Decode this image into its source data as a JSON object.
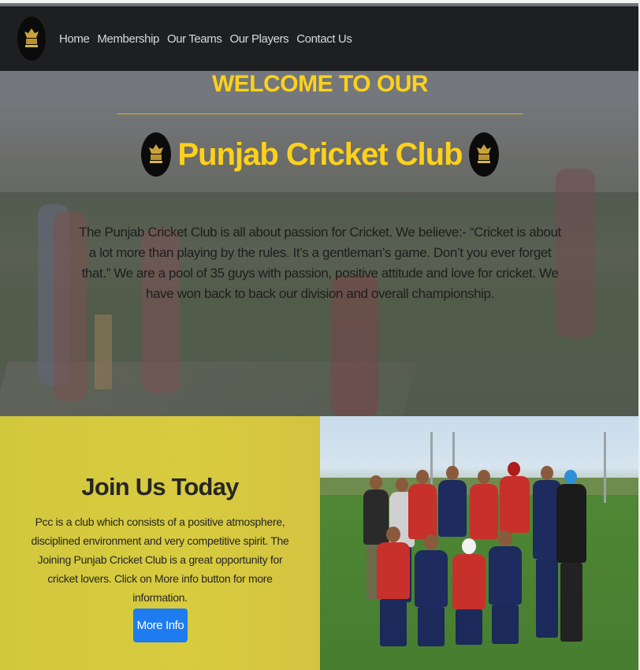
{
  "navbar": {
    "logo_icon": "punjab-cricket-club-crest",
    "links": [
      "Home",
      "Membership",
      "Our Teams",
      "Our Players",
      "Contact Us"
    ]
  },
  "hero": {
    "welcome": "WELCOME TO OUR",
    "club_name": "Punjab Cricket Club",
    "description": "The Punjab Cricket Club is all about passion for Cricket. We believe:- “Cricket is about a lot more than playing by the rules. It’s a gentleman’s game. Don’t you ever forget that.” We are a pool of 35 guys with passion, positive attitude and love for cricket. We have won back to back our division and overall championship."
  },
  "join": {
    "title": "Join Us Today",
    "text": "Pcc is a club which consists of a positive atmosphere, disciplined environment and very competitive spirit. The Joining Punjab Cricket Club is a great opportunity for cricket lovers. Click on More info button for more information.",
    "button_label": "More Info"
  },
  "colors": {
    "accent_yellow": "#ffd11a",
    "navbar_bg": "#1e1f21",
    "join_bg": "#d6c93f",
    "button_blue": "#1e7cf0"
  }
}
